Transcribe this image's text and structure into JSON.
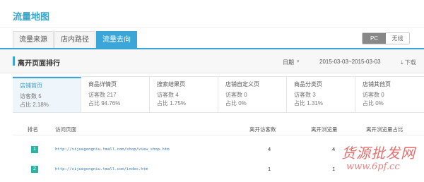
{
  "header": {
    "title": "流量地图"
  },
  "tabs": [
    {
      "label": "流量来源"
    },
    {
      "label": "店内路径"
    },
    {
      "label": "流量去向"
    }
  ],
  "device_toggle": {
    "pc": "PC",
    "wireless": "无线"
  },
  "section": {
    "title": "离开页面排行",
    "date_label": "日期",
    "date_range": "2015-03-03~2015-03-03",
    "download": "下载"
  },
  "cards": [
    {
      "name": "店铺首页",
      "visitors": "访客数 5",
      "share": "占比 2.18%"
    },
    {
      "name": "商品详情页",
      "visitors": "访客数 217",
      "share": "占比 94.76%"
    },
    {
      "name": "搜索结果页",
      "visitors": "访客数 4",
      "share": "占比 1.75%"
    },
    {
      "name": "店铺自定义页",
      "visitors": "访客数 0",
      "share": "占比 0%"
    },
    {
      "name": "商品分类页",
      "visitors": "访客数 3",
      "share": "占比 1.31%"
    },
    {
      "name": "店铺其他页",
      "visitors": "访客数 0",
      "share": "占比 0%"
    }
  ],
  "table": {
    "headers": {
      "rank": "排名",
      "page": "访问页面",
      "visitors": "离开访客数",
      "views": "离开浏览量",
      "share": "离开浏览量占比"
    },
    "rows": [
      {
        "rank": "1",
        "url": "http://xijuegongniu.tmall.com/shop/view_shop.htm",
        "visitors": "4",
        "views": "4"
      },
      {
        "rank": "2",
        "url": "http://xijuegongniu.tmall.com/index.htm",
        "visitors": "1",
        "views": "1"
      }
    ]
  },
  "watermark": {
    "line1": "货源批发网",
    "line2": "www.6pf.cc"
  },
  "colors": {
    "accent": "#3aa5d6",
    "rank_badge": "#2bb3a3",
    "watermark": "#e05555"
  }
}
